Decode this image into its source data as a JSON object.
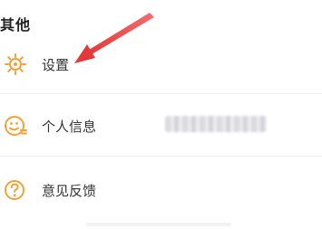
{
  "section": {
    "title": "其他"
  },
  "items": [
    {
      "label": "设置",
      "icon": "gear-icon"
    },
    {
      "label": "个人信息",
      "icon": "profile-face-icon"
    },
    {
      "label": "意见反馈",
      "icon": "question-icon"
    }
  ],
  "colors": {
    "accent_orange": "#f2a13a",
    "arrow_red": "#e23a3a",
    "text": "#333333",
    "divider": "#eeeeee"
  }
}
